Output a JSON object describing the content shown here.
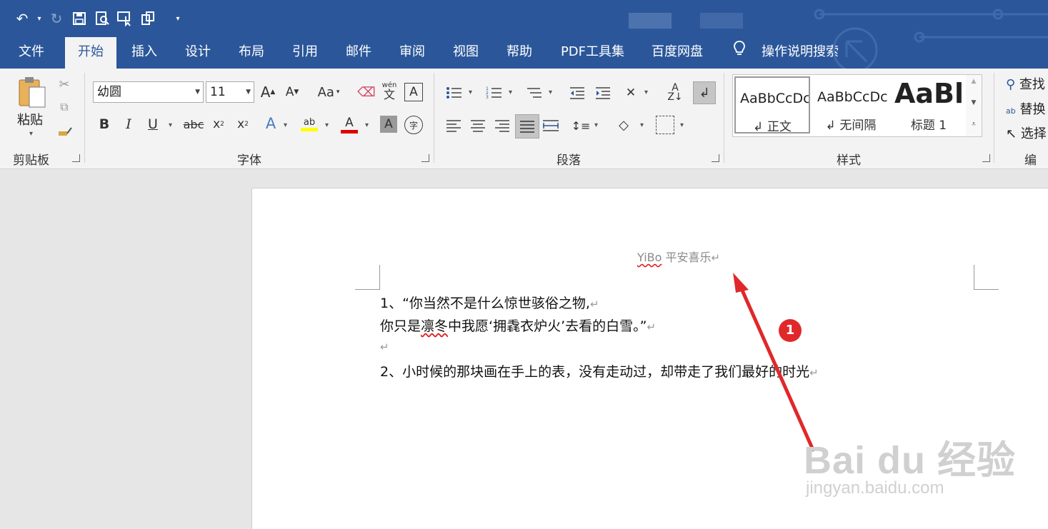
{
  "titlebar": {
    "undo_icon": "undo-icon",
    "redo_icon": "redo-icon",
    "save_icon": "save-icon",
    "preview_icon": "print-preview-icon",
    "touch_icon": "touch-mode-icon",
    "clipboard_icon": "clipboard-icon",
    "customize_icon": "customize-qat-icon"
  },
  "tabs": [
    {
      "label": "文件"
    },
    {
      "label": "开始"
    },
    {
      "label": "插入"
    },
    {
      "label": "设计"
    },
    {
      "label": "布局"
    },
    {
      "label": "引用"
    },
    {
      "label": "邮件"
    },
    {
      "label": "审阅"
    },
    {
      "label": "视图"
    },
    {
      "label": "帮助"
    },
    {
      "label": "PDF工具集"
    },
    {
      "label": "百度网盘"
    },
    {
      "label": "操作说明搜索"
    }
  ],
  "ribbon": {
    "clipboard": {
      "paste_label": "粘贴",
      "group_label": "剪贴板"
    },
    "font": {
      "font_name": "幼圆",
      "font_size": "11",
      "group_label": "字体",
      "wen_label": "wén",
      "wen_char": "文"
    },
    "paragraph": {
      "group_label": "段落"
    },
    "styles": {
      "group_label": "样式",
      "items": [
        {
          "preview": "AaBbCcDc",
          "name": "↲ 正文"
        },
        {
          "preview": "AaBbCcDc",
          "name": "↲ 无间隔"
        },
        {
          "preview": "AaBl",
          "name": "标题 1"
        }
      ]
    },
    "editing": {
      "find": "查找",
      "replace": "替换",
      "select": "选择",
      "group_label": "编辑"
    }
  },
  "document": {
    "header": {
      "name": "YiBo",
      "rest": " 平安喜乐",
      "mark": "↵"
    },
    "lines": [
      {
        "text": "1、“你当然不是什么惊世骇俗之物,",
        "mark": "↵"
      },
      {
        "pre": "你只是",
        "wavy": "凛冬",
        "post": "中我愿‘拥毳衣炉火’去看的白雪。”",
        "mark": "↵"
      },
      {
        "text": "",
        "mark": "↵"
      },
      {
        "text": "2、小时候的那块画在手上的表，没有走动过，却带走了我们最好的时光",
        "mark": "↵"
      }
    ]
  },
  "annotation": {
    "callout_number": "1",
    "color": "#e0282a"
  },
  "watermark": {
    "brand": "Bai du 经验",
    "url": "jingyan.baidu.com"
  },
  "colors": {
    "title_bar": "#2b579a",
    "highlight": "#ffff00",
    "font_color": "#e00000"
  }
}
